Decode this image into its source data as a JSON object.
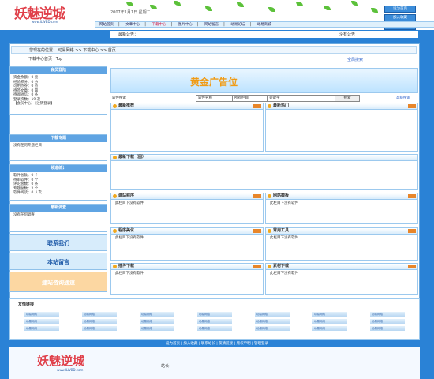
{
  "header": {
    "logo_text": "妖魅逆城",
    "logo_sub": "www.ILWBD.com",
    "date": "2007年1月1日 星期二",
    "top_buttons": [
      "设为首页",
      "加入收藏",
      "联系我们"
    ],
    "nav": [
      "网站首页",
      "文章中心",
      "下载中心",
      "图片中心",
      "网站留言",
      "动易论坛",
      "动易商城"
    ],
    "nav_active": "下载中心",
    "notice_label": "最新公告：",
    "notice_right": "没有公告"
  },
  "path": {
    "label": "您现在的位置：",
    "crumbs": [
      "动易网络",
      ">>",
      "下载中心",
      ">>",
      "首页"
    ]
  },
  "tabs": {
    "items": [
      "下载中心首页",
      "Top"
    ],
    "right": "全局搜索"
  },
  "member": {
    "title": "会员登陆",
    "lines": [
      "资金余额：0 元",
      "经验积分：0 分",
      "可用点券：0 点",
      "待签文章：0 篇",
      "待阅短信：0 条",
      "登录次数：19 次"
    ],
    "links": [
      "会员中心",
      "注销登录"
    ]
  },
  "special": {
    "title": "下载专题",
    "text": "没有任何专题栏目"
  },
  "stats": {
    "title": "频道统计",
    "lines": [
      "软件总数：0 个",
      "待审软件：0 个",
      "评论总数：0 条",
      "专题总数：2 个",
      "软件阅读：0 人次"
    ]
  },
  "survey": {
    "title": "最新调查",
    "text": "没有任何调查"
  },
  "side_buttons": [
    "联系我们",
    "本站留言",
    "建站咨询通道"
  ],
  "banner": {
    "title": "黄金广告位"
  },
  "search": {
    "label": "软件搜索",
    "field_select": "软件名称",
    "column_select": "所有栏目",
    "keyword": "关键字",
    "button": "搜索",
    "advanced": "高级搜索"
  },
  "panels": {
    "recommend": {
      "title": "最新推荐"
    },
    "hot": {
      "title": "最新热门"
    },
    "latest": {
      "title": "最新下载（图）"
    },
    "program": {
      "title": "建站程序",
      "text": "此栏目下没有软件"
    },
    "template": {
      "title": "网站模板",
      "text": "此栏目下没有软件"
    },
    "beautify": {
      "title": "程序美化",
      "text": "此栏目下没有软件"
    },
    "tools": {
      "title": "常用工具",
      "text": "此栏目下没有软件"
    },
    "plugin": {
      "title": "插件下载",
      "text": "此栏目下没有软件"
    },
    "material": {
      "title": "素材下载",
      "text": "此栏目下没有软件"
    }
  },
  "friend_links": {
    "title": "友情链接",
    "cells": [
      "动易网络",
      "动易网络",
      "动易网络",
      "动易网络",
      "动易网络",
      "动易网络",
      "动易网络",
      "动易网络",
      "动易网络",
      "动易网络",
      "动易网络",
      "动易网络",
      "动易网络",
      "动易网络",
      "动易网络",
      "动易网络",
      "动易网络",
      "动易网络",
      "动易网络",
      "动易网络",
      "动易网络"
    ]
  },
  "footer": {
    "links": [
      "设为首页",
      "加入收藏",
      "联系站长",
      "友情链接",
      "版权申明",
      "管理登录"
    ],
    "logo_text": "妖魅逆城",
    "logo_sub": "www.ILWBD.com",
    "info": "站长："
  },
  "colors": {
    "background": "#2a82d6",
    "accent": "#f19a12",
    "nav_active": "#cc0033"
  }
}
